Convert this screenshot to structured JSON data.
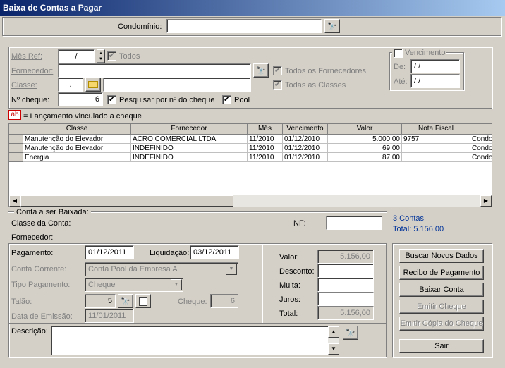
{
  "window": {
    "title": "Baixa de Contas a Pagar"
  },
  "condominio": {
    "label": "Condomínio:",
    "value": ""
  },
  "filters": {
    "mes_ref_label": "Mês Ref:",
    "mes_ref_value": "/",
    "todos_label": "Todos",
    "todos_checked": "✔",
    "fornecedor_label": "Fornecedor:",
    "fornecedor_value": "",
    "todos_fornecedores_label": "Todos os Fornecedores",
    "todos_fornecedores_checked": "✔",
    "classe_label": "Classe:",
    "classe_code": ".",
    "classe_value": "",
    "todas_classes_label": "Todas as Classes",
    "todas_classes_checked": "✔",
    "nro_cheque_label": "Nº cheque:",
    "nro_cheque_value": "6",
    "pesquisar_label": "Pesquisar por nº do cheque",
    "pesquisar_checked": "✔",
    "pool_label": "Pool",
    "pool_checked": "✔",
    "vencimento": {
      "label": "Vencimento",
      "de_label": "De:",
      "de_value": "/ /",
      "ate_label": "Até:",
      "ate_value": "/ /"
    }
  },
  "legend": {
    "badge": "ab",
    "text": "= Lançamento vinculado a cheque"
  },
  "grid": {
    "columns": [
      "Classe",
      "Fornecedor",
      "Mês",
      "Vencimento",
      "Valor",
      "Nota Fiscal",
      ""
    ],
    "rows": [
      [
        "Manutenção do Elevador",
        "ACRO COMERCIAL LTDA",
        "11/2010",
        "01/12/2010",
        "5.000,00",
        "9757",
        "Condo"
      ],
      [
        "Manutenção do Elevador",
        "INDEFINIDO",
        "11/2010",
        "01/12/2010",
        "69,00",
        "",
        "Condo"
      ],
      [
        "Energia",
        "INDEFINIDO",
        "11/2010",
        "01/12/2010",
        "87,00",
        "",
        "Condo"
      ]
    ]
  },
  "summary": {
    "contas": "3 Contas",
    "total": "Total: 5.156,00"
  },
  "baixa": {
    "section_label": "Conta a ser Baixada:",
    "classe_label": "Classe da Conta:",
    "nf_label": "NF:",
    "nf_value": "",
    "fornecedor_label": "Fornecedor:",
    "pagamento_label": "Pagamento:",
    "pagamento_value": "01/12/2011",
    "liquidacao_label": "Liquidação:",
    "liquidacao_value": "03/12/2011",
    "conta_corrente_label": "Conta Corrente:",
    "conta_corrente_value": "Conta Pool da Empresa A",
    "tipo_pagamento_label": "Tipo Pagamento:",
    "tipo_pagamento_value": "Cheque",
    "talao_label": "Talão:",
    "talao_value": "5",
    "cheque_label": "Cheque:",
    "cheque_value": "6",
    "data_emissao_label": "Data de Emissão:",
    "data_emissao_value": "11/01/2011",
    "descricao_label": "Descrição:",
    "descricao_value": ""
  },
  "valores": {
    "valor_label": "Valor:",
    "valor_value": "5.156,00",
    "desconto_label": "Desconto:",
    "desconto_value": "",
    "multa_label": "Multa:",
    "multa_value": "",
    "juros_label": "Juros:",
    "juros_value": "",
    "total_label": "Total:",
    "total_value": "5.156,00"
  },
  "buttons": {
    "buscar": "Buscar Novos Dados",
    "recibo": "Recibo de Pagamento",
    "baixar": "Baixar Conta",
    "emitir_cheque": "Emitir Cheque",
    "emitir_copia": "Emitir Cópia do Cheque",
    "sair": "Sair"
  }
}
